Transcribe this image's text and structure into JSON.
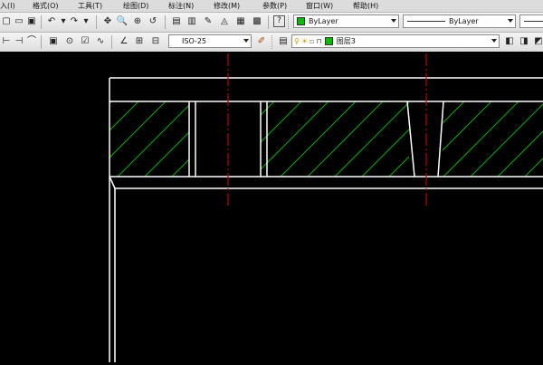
{
  "menubar": {
    "items": [
      "入(I)",
      "格式(O)",
      "工具(T)",
      "绘图(D)",
      "标注(N)",
      "修改(M)",
      "参数(P)",
      "窗口(W)",
      "帮助(H)"
    ]
  },
  "toolbar1": {
    "color_value": "ByLayer",
    "linetype_value": "ByLayer",
    "color_swatch": "#00c000"
  },
  "toolbar2": {
    "dimstyle_value": "ISO-25",
    "layer_value": "图层3",
    "layer_swatch": "#00c000"
  },
  "drawing": {
    "background": "#000000",
    "outline_color": "#ffffff",
    "hatch_color": "#00b400",
    "centerline_color": "#c00000"
  }
}
